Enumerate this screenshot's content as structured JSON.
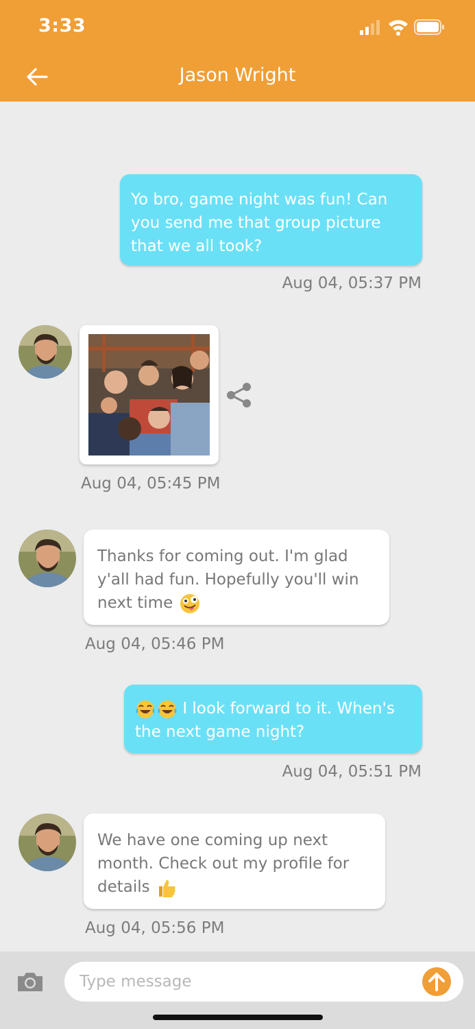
{
  "status_bar": {
    "time": "3:33"
  },
  "header": {
    "title": "Jason Wright",
    "back_icon": "arrow-left-icon",
    "color": "#f09e36"
  },
  "colors": {
    "my_bubble": "#6ae0f6",
    "their_bubble": "#ffffff",
    "background": "#ececec"
  },
  "messages": [
    {
      "from": "me",
      "text": "Yo bro, game night was fun! Can you send me that group picture that we all took?",
      "time": "Aug 04, 05:37 PM"
    },
    {
      "from": "them",
      "type": "image",
      "time": "Aug 04, 05:45 PM"
    },
    {
      "from": "them",
      "text": "Thanks for coming out. I'm glad y'all had fun. Hopefully you'll win next time",
      "emoji": "zany-face",
      "time": "Aug 04, 05:46 PM"
    },
    {
      "from": "me",
      "emoji": "tears-of-joy x2",
      "text": "I look forward to it. When's the next game night?",
      "time": "Aug 04, 05:51 PM"
    },
    {
      "from": "them",
      "text": "We have one coming up next month. Check out my profile for details",
      "emoji": "thumbs-up",
      "time": "Aug 04, 05:56 PM"
    }
  ],
  "composer": {
    "placeholder": "Type message",
    "camera_icon": "camera-icon",
    "send_icon": "send-arrow-up-icon"
  }
}
